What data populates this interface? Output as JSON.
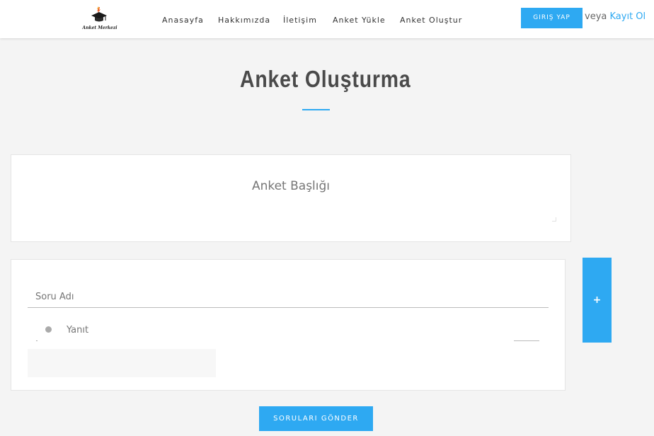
{
  "header": {
    "logo_text": "Anket Merkezi",
    "nav": [
      "Anasayfa",
      "Hakkımızda",
      "İletişim",
      "Anket Yükle",
      "Anket Oluştur"
    ],
    "login_label": "GIRIŞ YAP",
    "or_text": "veya",
    "register_label": "Kayıt Ol"
  },
  "page": {
    "title": "Anket Oluşturma"
  },
  "survey": {
    "title_placeholder": "Anket Başlığı",
    "question_placeholder": "Soru Adı",
    "answer_placeholder": "Yanıt",
    "add_question_label": "+",
    "submit_label": "SORULARI GÖNDER"
  },
  "colors": {
    "accent": "#2ea9f2",
    "background": "#f4f4f4",
    "card": "#ffffff",
    "title": "#4a4a4a"
  },
  "icons": {
    "logo": "graduation-cap-logo-icon"
  }
}
